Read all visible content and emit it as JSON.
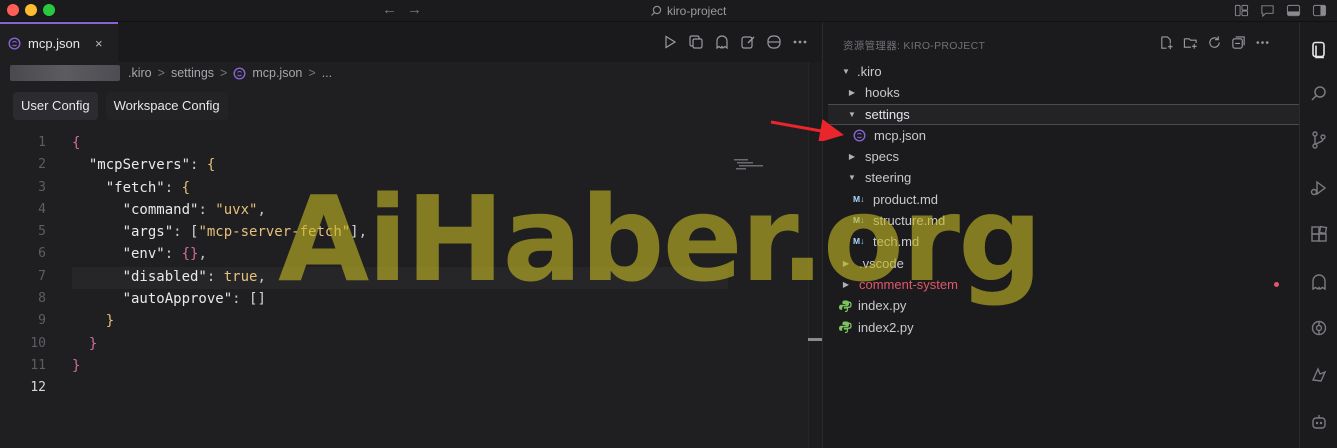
{
  "titlebar": {
    "search_text": "kiro-project",
    "back_icon": "arrow-left-icon",
    "forward_icon": "arrow-right-icon"
  },
  "editor": {
    "tab": {
      "label": "mcp.json",
      "close": "×"
    },
    "breadcrumb": [
      ".kiro",
      "settings",
      "mcp.json",
      "..."
    ],
    "breadcrumb_sep": ">",
    "config_buttons": [
      "User Config",
      "Workspace Config"
    ],
    "line_numbers": [
      "1",
      "2",
      "3",
      "4",
      "5",
      "6",
      "7",
      "8",
      "9",
      "10",
      "11",
      "12"
    ],
    "current_line": "12"
  },
  "explorer": {
    "title": "资源管理器: KIRO-PROJECT",
    "items": [
      {
        "label": ".kiro",
        "type": "folder-open"
      },
      {
        "label": "hooks",
        "type": "folder"
      },
      {
        "label": "settings",
        "type": "folder-open"
      },
      {
        "label": "mcp.json",
        "type": "file-json"
      },
      {
        "label": "specs",
        "type": "folder"
      },
      {
        "label": "steering",
        "type": "folder-open"
      },
      {
        "label": "product.md",
        "type": "file-md"
      },
      {
        "label": "structure.md",
        "type": "file-md"
      },
      {
        "label": "tech.md",
        "type": "file-md"
      },
      {
        "label": ".vscode",
        "type": "folder"
      },
      {
        "label": "comment-system",
        "type": "folder"
      },
      {
        "label": "index.py",
        "type": "file-py"
      },
      {
        "label": "index2.py",
        "type": "file-py"
      }
    ],
    "md_badge": "M↓"
  },
  "watermark": "AiHaber.org",
  "colors": {
    "accent": "#8a63d2",
    "error": "#e2566a",
    "arrow": "#e8262b",
    "watermark": "#c4b724"
  }
}
